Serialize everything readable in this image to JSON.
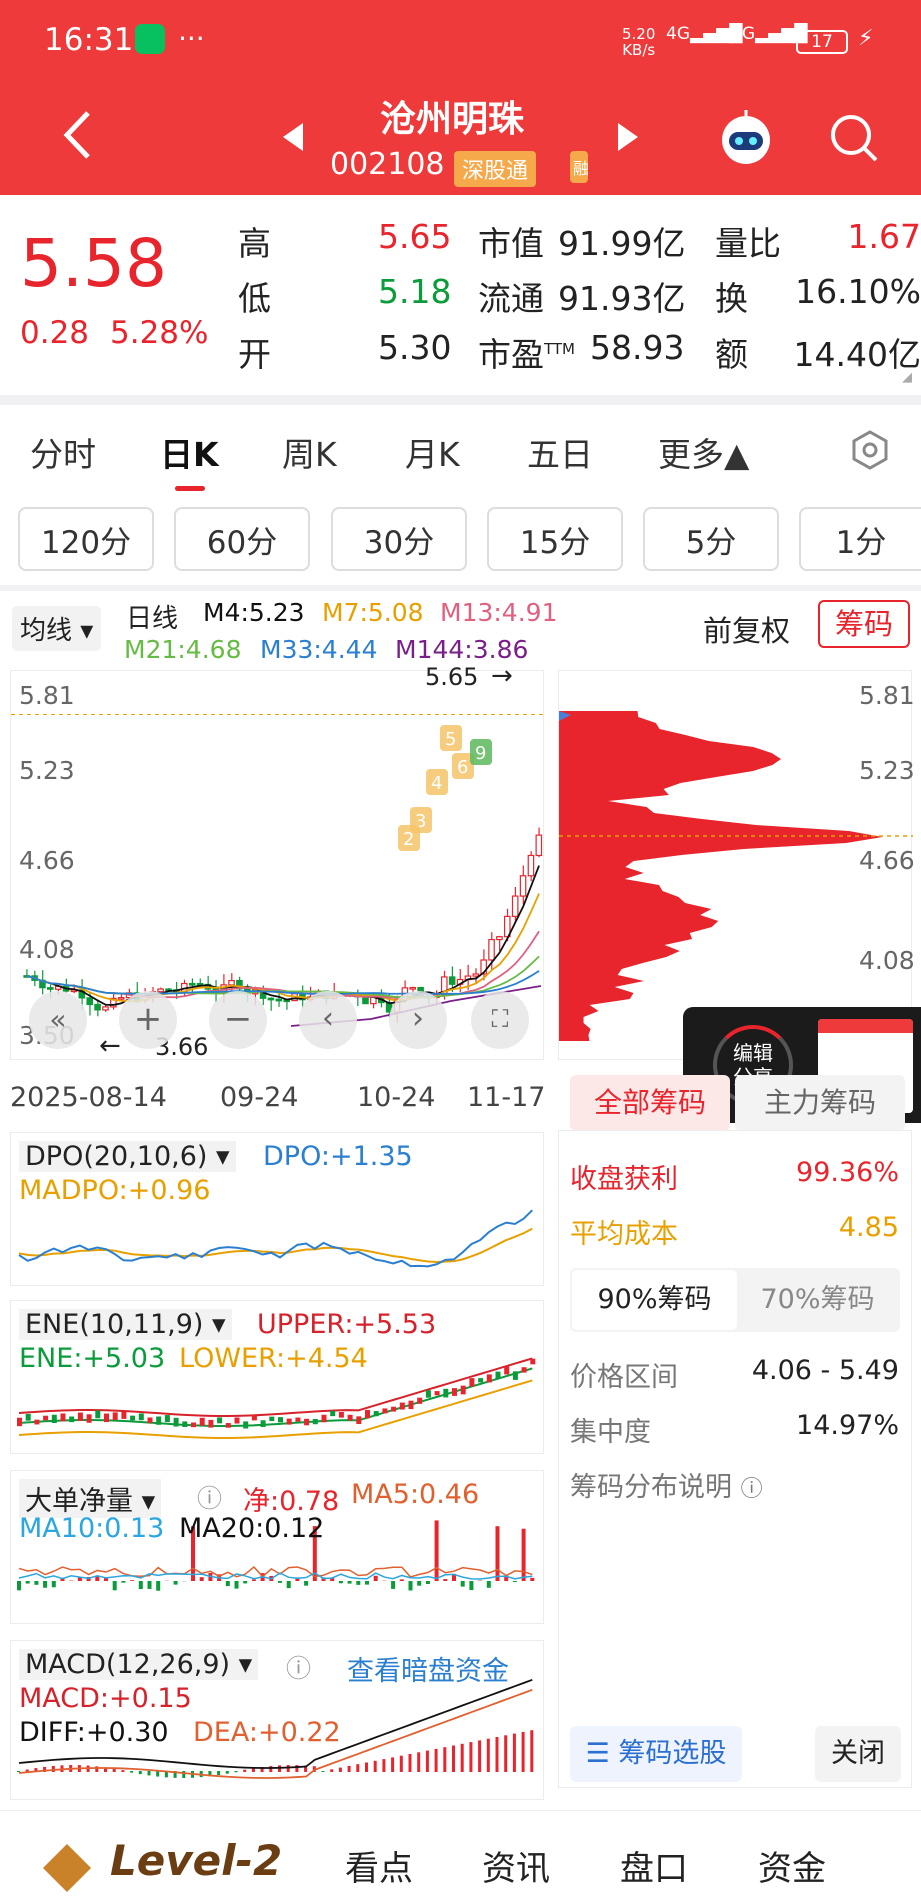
{
  "status_bar": {
    "time": "16:31",
    "net_speed": "5.20\nKB/s",
    "signal1": "4G",
    "signal2": "4G",
    "battery": "17"
  },
  "header": {
    "title": "沧州明珠",
    "code": "002108",
    "tag": "深股通",
    "tag2": "融"
  },
  "quote": {
    "price": "5.58",
    "change": "0.28",
    "change_pct": "5.28%",
    "rows": [
      {
        "l1": "高",
        "v1": "5.65",
        "l2": "市值",
        "v2": "91.99亿",
        "l3": "量比",
        "v3": "1.67"
      },
      {
        "l1": "低",
        "v1": "5.18",
        "l2": "流通",
        "v2": "91.93亿",
        "l3": "换",
        "v3": "16.10%"
      },
      {
        "l1": "开",
        "v1": "5.30",
        "l2": "市盈",
        "l2sup": "TTM",
        "v2": "58.93",
        "l3": "额",
        "v3": "14.40亿"
      }
    ]
  },
  "period_tabs": [
    "分时",
    "日K",
    "周K",
    "月K",
    "五日",
    "更多▲"
  ],
  "minute_pills": [
    "120分",
    "60分",
    "30分",
    "15分",
    "5分",
    "1分"
  ],
  "chart_header": {
    "ma_select": "均线",
    "line_type": "日线",
    "m4": "M4:5.23",
    "m7": "M7:5.08",
    "m13": "M13:4.91",
    "m21": "M21:4.68",
    "m33": "M33:4.44",
    "m144": "M144:3.86",
    "fq": "前复权",
    "chip_btn": "筹码"
  },
  "main_chart": {
    "y_labels": [
      "5.81",
      "5.23",
      "4.66",
      "4.08",
      "3.50"
    ],
    "high_mark": "5.65",
    "low_mark": "3.66",
    "x_labels": [
      "2025-08-14",
      "09-24",
      "10-24",
      "11-17"
    ],
    "markers": [
      "5",
      "6",
      "4",
      "3",
      "2",
      "9"
    ]
  },
  "chip_chart": {
    "y_labels": [
      "5.81",
      "5.23",
      "4.66",
      "4.08"
    ]
  },
  "edit_share": "编辑\n分享",
  "chip_tabs": {
    "all": "全部筹码",
    "main": "主力筹码"
  },
  "chip_stats": {
    "profit_label": "收盘获利",
    "profit": "99.36%",
    "avg_label": "平均成本",
    "avg": "4.85",
    "tab90": "90%筹码",
    "tab70": "70%筹码",
    "range_label": "价格区间",
    "range": "4.06 - 5.49",
    "conc_label": "集中度",
    "conc": "14.97%",
    "explain": "筹码分布说明",
    "select_btn": "筹码选股",
    "close_btn": "关闭"
  },
  "dpo": {
    "name": "DPO(20,10,6)",
    "dpo": "DPO:+1.35",
    "madpo": "MADPO:+0.96"
  },
  "ene": {
    "name": "ENE(10,11,9)",
    "upper": "UPPER:+5.53",
    "ene": "ENE:+5.03",
    "lower": "LOWER:+4.54"
  },
  "ddj": {
    "name": "大单净量",
    "net": "净:0.78",
    "ma5": "MA5:0.46",
    "ma10": "MA10:0.13",
    "ma20": "MA20:0.12"
  },
  "macd": {
    "name": "MACD(12,26,9)",
    "link": "查看暗盘资金",
    "macd": "MACD:+0.15",
    "diff": "DIFF:+0.30",
    "dea": "DEA:+0.22"
  },
  "bottom_nav": {
    "level2": "Level-2",
    "items": [
      "看点",
      "资讯",
      "盘口",
      "资金"
    ]
  },
  "colors": {
    "header": "#ee3a3a",
    "up": "#e8242d",
    "down": "#0b9b3a",
    "m4": "#111111",
    "m7": "#e8a000",
    "m13": "#e06080",
    "m21": "#66bb44",
    "m33": "#2b7fd0",
    "m144": "#7a1f8a"
  }
}
